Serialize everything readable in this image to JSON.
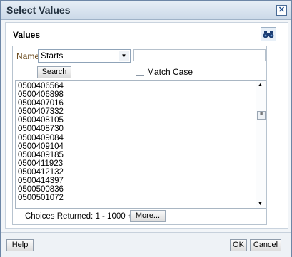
{
  "dialog": {
    "title": "Select Values",
    "close_glyph": "✕"
  },
  "section": {
    "title": "Values",
    "icon": "binoculars-icon"
  },
  "filter": {
    "name_label": "Name",
    "operator": "Starts",
    "text_value": "",
    "search_label": "Search",
    "match_case_label": "Match Case",
    "match_case_checked": false
  },
  "values": [
    "0500406564",
    "0500406898",
    "0500407016",
    "0500407332",
    "0500408105",
    "0500408730",
    "0500409084",
    "0500409104",
    "0500409185",
    "0500411923",
    "0500412132",
    "0500414397",
    "0500500836",
    "0500501072"
  ],
  "choices": {
    "label": "Choices Returned:  1 - 1000 +",
    "more_label": "More..."
  },
  "footer": {
    "help_label": "Help",
    "ok_label": "OK",
    "cancel_label": "Cancel"
  }
}
